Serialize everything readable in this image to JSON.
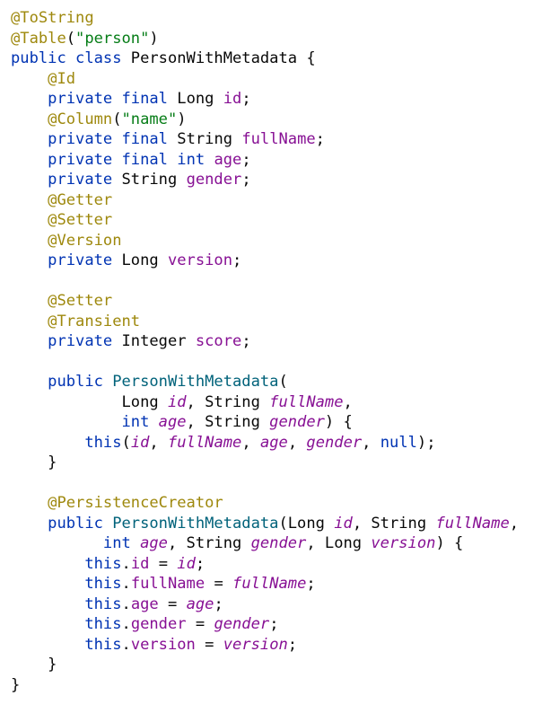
{
  "editor": {
    "lines": [
      [
        {
          "t": "@ToString",
          "k": "annotation"
        }
      ],
      [
        {
          "t": "@Table",
          "k": "annotation"
        },
        {
          "t": "(",
          "k": "plain"
        },
        {
          "t": "\"person\"",
          "k": "string"
        },
        {
          "t": ")",
          "k": "plain"
        }
      ],
      [
        {
          "t": "public",
          "k": "keyword"
        },
        {
          "t": " ",
          "k": "plain"
        },
        {
          "t": "class",
          "k": "keyword"
        },
        {
          "t": " PersonWithMetadata {",
          "k": "plain"
        }
      ],
      [
        {
          "t": "    ",
          "k": "plain"
        },
        {
          "t": "@Id",
          "k": "annotation"
        }
      ],
      [
        {
          "t": "    ",
          "k": "plain"
        },
        {
          "t": "private",
          "k": "keyword"
        },
        {
          "t": " ",
          "k": "plain"
        },
        {
          "t": "final",
          "k": "keyword"
        },
        {
          "t": " Long ",
          "k": "plain"
        },
        {
          "t": "id",
          "k": "field"
        },
        {
          "t": ";",
          "k": "plain"
        }
      ],
      [
        {
          "t": "    ",
          "k": "plain"
        },
        {
          "t": "@Column",
          "k": "annotation"
        },
        {
          "t": "(",
          "k": "plain"
        },
        {
          "t": "\"name\"",
          "k": "string"
        },
        {
          "t": ")",
          "k": "plain"
        }
      ],
      [
        {
          "t": "    ",
          "k": "plain"
        },
        {
          "t": "private",
          "k": "keyword"
        },
        {
          "t": " ",
          "k": "plain"
        },
        {
          "t": "final",
          "k": "keyword"
        },
        {
          "t": " String ",
          "k": "plain"
        },
        {
          "t": "fullName",
          "k": "field"
        },
        {
          "t": ";",
          "k": "plain"
        }
      ],
      [
        {
          "t": "    ",
          "k": "plain"
        },
        {
          "t": "private",
          "k": "keyword"
        },
        {
          "t": " ",
          "k": "plain"
        },
        {
          "t": "final",
          "k": "keyword"
        },
        {
          "t": " ",
          "k": "plain"
        },
        {
          "t": "int",
          "k": "keyword"
        },
        {
          "t": " ",
          "k": "plain"
        },
        {
          "t": "age",
          "k": "field"
        },
        {
          "t": ";",
          "k": "plain"
        }
      ],
      [
        {
          "t": "    ",
          "k": "plain"
        },
        {
          "t": "private",
          "k": "keyword"
        },
        {
          "t": " String ",
          "k": "plain"
        },
        {
          "t": "gender",
          "k": "field"
        },
        {
          "t": ";",
          "k": "plain"
        }
      ],
      [
        {
          "t": "    ",
          "k": "plain"
        },
        {
          "t": "@Getter",
          "k": "annotation"
        }
      ],
      [
        {
          "t": "    ",
          "k": "plain"
        },
        {
          "t": "@Setter",
          "k": "annotation"
        }
      ],
      [
        {
          "t": "    ",
          "k": "plain"
        },
        {
          "t": "@Version",
          "k": "annotation"
        }
      ],
      [
        {
          "t": "    ",
          "k": "plain"
        },
        {
          "t": "private",
          "k": "keyword"
        },
        {
          "t": " Long ",
          "k": "plain"
        },
        {
          "t": "version",
          "k": "field"
        },
        {
          "t": ";",
          "k": "plain"
        }
      ],
      [],
      [
        {
          "t": "    ",
          "k": "plain"
        },
        {
          "t": "@Setter",
          "k": "annotation"
        }
      ],
      [
        {
          "t": "    ",
          "k": "plain"
        },
        {
          "t": "@Transient",
          "k": "annotation"
        }
      ],
      [
        {
          "t": "    ",
          "k": "plain"
        },
        {
          "t": "private",
          "k": "keyword"
        },
        {
          "t": " Integer ",
          "k": "plain"
        },
        {
          "t": "score",
          "k": "field"
        },
        {
          "t": ";",
          "k": "plain"
        }
      ],
      [],
      [
        {
          "t": "    ",
          "k": "plain"
        },
        {
          "t": "public",
          "k": "keyword"
        },
        {
          "t": " ",
          "k": "plain"
        },
        {
          "t": "PersonWithMetadata",
          "k": "method-decl"
        },
        {
          "t": "(",
          "k": "plain"
        }
      ],
      [
        {
          "t": "            Long ",
          "k": "plain"
        },
        {
          "t": "id",
          "k": "param"
        },
        {
          "t": ", String ",
          "k": "plain"
        },
        {
          "t": "fullName",
          "k": "param"
        },
        {
          "t": ",",
          "k": "plain"
        }
      ],
      [
        {
          "t": "            ",
          "k": "plain"
        },
        {
          "t": "int",
          "k": "keyword"
        },
        {
          "t": " ",
          "k": "plain"
        },
        {
          "t": "age",
          "k": "param"
        },
        {
          "t": ", String ",
          "k": "plain"
        },
        {
          "t": "gender",
          "k": "param"
        },
        {
          "t": ") {",
          "k": "plain"
        }
      ],
      [
        {
          "t": "        ",
          "k": "plain"
        },
        {
          "t": "this",
          "k": "keyword"
        },
        {
          "t": "(",
          "k": "plain"
        },
        {
          "t": "id",
          "k": "param"
        },
        {
          "t": ", ",
          "k": "plain"
        },
        {
          "t": "fullName",
          "k": "param"
        },
        {
          "t": ", ",
          "k": "plain"
        },
        {
          "t": "age",
          "k": "param"
        },
        {
          "t": ", ",
          "k": "plain"
        },
        {
          "t": "gender",
          "k": "param"
        },
        {
          "t": ", ",
          "k": "plain"
        },
        {
          "t": "null",
          "k": "keyword"
        },
        {
          "t": ");",
          "k": "plain"
        }
      ],
      [
        {
          "t": "    }",
          "k": "plain"
        }
      ],
      [],
      [
        {
          "t": "    ",
          "k": "plain"
        },
        {
          "t": "@PersistenceCreator",
          "k": "annotation"
        }
      ],
      [
        {
          "t": "    ",
          "k": "plain"
        },
        {
          "t": "public",
          "k": "keyword"
        },
        {
          "t": " ",
          "k": "plain"
        },
        {
          "t": "PersonWithMetadata",
          "k": "method-decl"
        },
        {
          "t": "(Long ",
          "k": "plain"
        },
        {
          "t": "id",
          "k": "param"
        },
        {
          "t": ", String ",
          "k": "plain"
        },
        {
          "t": "fullName",
          "k": "param"
        },
        {
          "t": ",",
          "k": "plain"
        }
      ],
      [
        {
          "t": "          ",
          "k": "plain"
        },
        {
          "t": "int",
          "k": "keyword"
        },
        {
          "t": " ",
          "k": "plain"
        },
        {
          "t": "age",
          "k": "param"
        },
        {
          "t": ", String ",
          "k": "plain"
        },
        {
          "t": "gender",
          "k": "param"
        },
        {
          "t": ", Long ",
          "k": "plain"
        },
        {
          "t": "version",
          "k": "param"
        },
        {
          "t": ") {",
          "k": "plain"
        }
      ],
      [
        {
          "t": "        ",
          "k": "plain"
        },
        {
          "t": "this",
          "k": "keyword"
        },
        {
          "t": ".",
          "k": "plain"
        },
        {
          "t": "id",
          "k": "field"
        },
        {
          "t": " = ",
          "k": "plain"
        },
        {
          "t": "id",
          "k": "param"
        },
        {
          "t": ";",
          "k": "plain"
        }
      ],
      [
        {
          "t": "        ",
          "k": "plain"
        },
        {
          "t": "this",
          "k": "keyword"
        },
        {
          "t": ".",
          "k": "plain"
        },
        {
          "t": "fullName",
          "k": "field"
        },
        {
          "t": " = ",
          "k": "plain"
        },
        {
          "t": "fullName",
          "k": "param"
        },
        {
          "t": ";",
          "k": "plain"
        }
      ],
      [
        {
          "t": "        ",
          "k": "plain"
        },
        {
          "t": "this",
          "k": "keyword"
        },
        {
          "t": ".",
          "k": "plain"
        },
        {
          "t": "age",
          "k": "field"
        },
        {
          "t": " = ",
          "k": "plain"
        },
        {
          "t": "age",
          "k": "param"
        },
        {
          "t": ";",
          "k": "plain"
        }
      ],
      [
        {
          "t": "        ",
          "k": "plain"
        },
        {
          "t": "this",
          "k": "keyword"
        },
        {
          "t": ".",
          "k": "plain"
        },
        {
          "t": "gender",
          "k": "field"
        },
        {
          "t": " = ",
          "k": "plain"
        },
        {
          "t": "gender",
          "k": "param"
        },
        {
          "t": ";",
          "k": "plain"
        }
      ],
      [
        {
          "t": "        ",
          "k": "plain"
        },
        {
          "t": "this",
          "k": "keyword"
        },
        {
          "t": ".",
          "k": "plain"
        },
        {
          "t": "version",
          "k": "field"
        },
        {
          "t": " = ",
          "k": "plain"
        },
        {
          "t": "version",
          "k": "param"
        },
        {
          "t": ";",
          "k": "plain"
        }
      ],
      [
        {
          "t": "    }",
          "k": "plain"
        }
      ],
      [
        {
          "t": "}",
          "k": "plain"
        }
      ]
    ]
  }
}
